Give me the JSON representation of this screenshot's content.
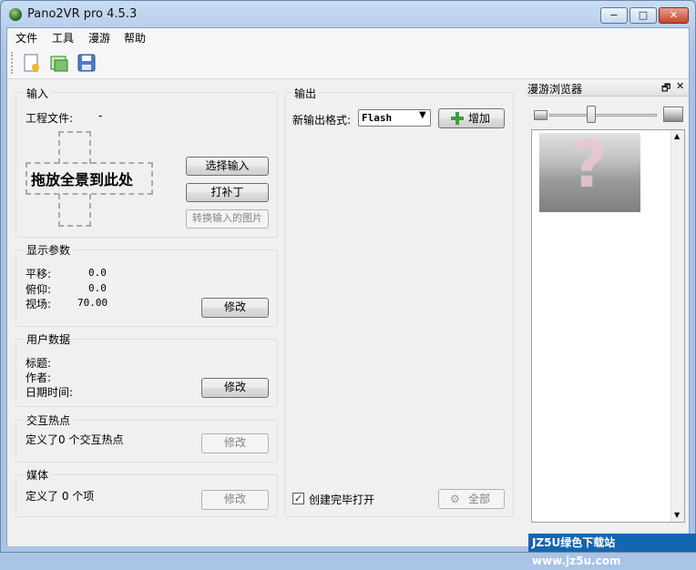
{
  "window": {
    "title": "Pano2VR pro 4.5.3",
    "min": "−",
    "max": "□",
    "close": "✕"
  },
  "menu": [
    "文件",
    "工具",
    "漫游",
    "帮助"
  ],
  "toolbar": {
    "icons": [
      "new-project-icon",
      "open-project-icon",
      "save-icon"
    ]
  },
  "input": {
    "legend": "输入",
    "project_label": "工程文件:",
    "project_value": "-",
    "drop_text": "拖放全景到此处",
    "choose_button": "选择输入",
    "patch_button": "打补丁",
    "convert_button": "转换输入的图片"
  },
  "display": {
    "legend": "显示参数",
    "pan_label": "平移:",
    "pan_value": "0.0",
    "tilt_label": "俯仰:",
    "tilt_value": "0.0",
    "fov_label": "视场:",
    "fov_value": "70.00",
    "modify_button": "修改"
  },
  "userdata": {
    "legend": "用户数据",
    "title_label": "标题:",
    "author_label": "作者:",
    "datetime_label": "日期时间:",
    "modify_button": "修改"
  },
  "hotspots": {
    "legend": "交互热点",
    "text": "定义了0 个交互热点",
    "modify_button": "修改"
  },
  "media": {
    "legend": "媒体",
    "text": "定义了 0 个项",
    "modify_button": "修改"
  },
  "output": {
    "legend": "输出",
    "format_label": "新输出格式:",
    "format_value": "Flash",
    "add_button": "增加",
    "open_after_label": "创建完毕打开",
    "open_after_checked": true,
    "all_button": "全部"
  },
  "browser": {
    "title": "漫游浏览器",
    "float": "🗗",
    "close": "✕",
    "zoom_level": 0.38
  },
  "watermark": "JZ5U绿色下载站 www.jz5u.com"
}
